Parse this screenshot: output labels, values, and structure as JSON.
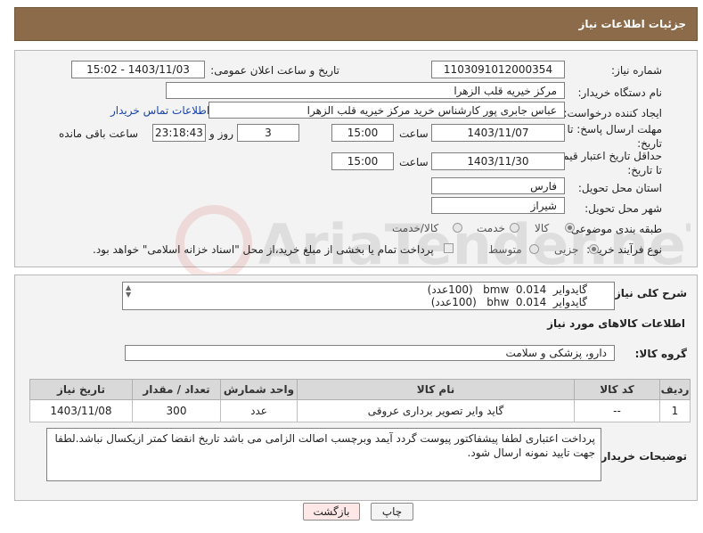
{
  "header": {
    "title": "جزئیات اطلاعات نیاز"
  },
  "fields": {
    "need_number_label": "شماره نیاز:",
    "need_number": "1103091012000354",
    "announce_label": "تاریخ و ساعت اعلان عمومی:",
    "announce_value": "1403/11/03 - 15:02",
    "buyer_org_label": "نام دستگاه خریدار:",
    "buyer_org": "مرکز خیریه قلب الزهرا",
    "creator_label": "ایجاد کننده درخواست:",
    "creator": "عباس جابری پور کارشناس خرید مرکز خیریه قلب الزهرا",
    "buyer_contact_link": "اطلاعات تماس خریدار",
    "reply_deadline_label": "مهلت ارسال پاسخ: تا تاریخ:",
    "reply_date": "1403/11/07",
    "time_label": "ساعت",
    "reply_time": "15:00",
    "days_value": "3",
    "days_label": "روز و",
    "remaining_time": "23:18:43",
    "remaining_label": "ساعت باقی مانده",
    "price_deadline_label": "حداقل تاریخ اعتبار قیمت: تا تاریخ:",
    "price_date": "1403/11/30",
    "price_time": "15:00",
    "province_label": "استان محل تحویل:",
    "province": "فارس",
    "city_label": "شهر محل تحویل:",
    "city": "شیراز",
    "category_label": "طبقه بندی موضوعی:",
    "category_options": [
      "کالا",
      "خدمت",
      "کالا/خدمت"
    ],
    "process_label": "نوع فرآیند خرید :",
    "process_options": [
      "جزیی",
      "متوسط"
    ],
    "payment_note": "پرداخت تمام یا بخشی از مبلغ خرید،از محل \"اسناد خزانه اسلامی\" خواهد بود."
  },
  "summary": {
    "label": "شرح کلی نیاز:",
    "lines": [
      "گایدوایر  bmw  0.014   (100عدد)",
      "گایدوایر  bhw  0.014   (100عدد)"
    ]
  },
  "goods": {
    "section_title": "اطلاعات کالاهای مورد نیاز",
    "group_label": "گروه کالا:",
    "group_value": "دارو، پزشکی و سلامت",
    "columns": [
      "ردیف",
      "کد کالا",
      "نام کالا",
      "واحد شمارش",
      "تعداد / مقدار",
      "تاریخ نیاز"
    ],
    "rows": [
      {
        "row": "1",
        "code": "--",
        "name": "گاید وایر تصویر برداری عروقی",
        "unit": "عدد",
        "qty": "300",
        "date": "1403/11/08"
      }
    ]
  },
  "notes": {
    "label": "توضیحات خریدار:",
    "text": "پرداخت اعتباری لطفا پیشفاکتور پیوست گردد آیمد وبرچسب اصالت الزامی می باشد تاریخ انقضا کمتر ازیکسال نباشد.لطفا جهت تایید نمونه ارسال شود."
  },
  "buttons": {
    "print": "چاپ",
    "back": "بازگشت"
  },
  "watermark": "AriaTender.neT",
  "colors": {
    "header_bg": "#8b6b4a",
    "back_button": "#fde7e7",
    "link": "#1a44a8"
  }
}
